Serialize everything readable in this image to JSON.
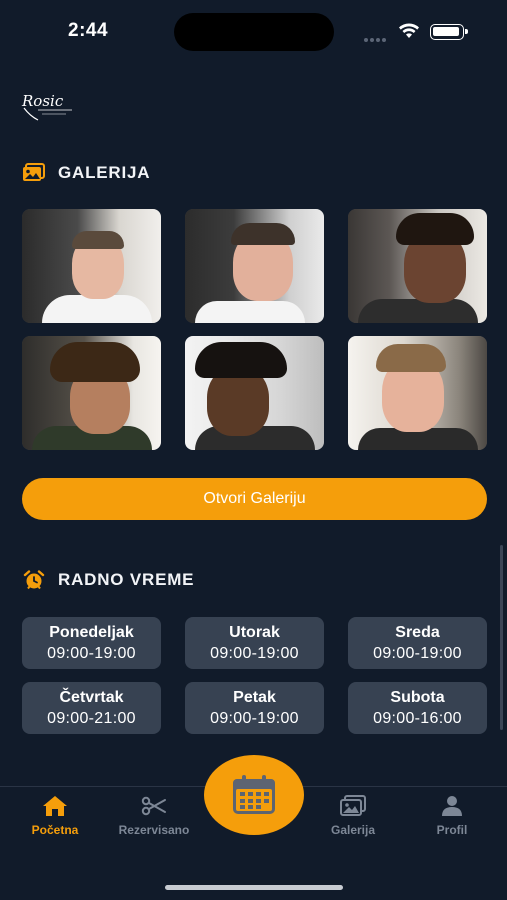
{
  "status_bar": {
    "time": "2:44"
  },
  "logo": {
    "name": "Rosic"
  },
  "gallery": {
    "title": "GALERIJA",
    "button_label": "Otvori Galeriju",
    "photos": [
      "haircut-photo",
      "haircut-photo",
      "haircut-photo",
      "haircut-photo",
      "haircut-photo",
      "haircut-photo"
    ]
  },
  "hours": {
    "title": "RADNO VREME",
    "days": [
      {
        "day": "Ponedeljak",
        "time": "09:00-19:00"
      },
      {
        "day": "Utorak",
        "time": "09:00-19:00"
      },
      {
        "day": "Sreda",
        "time": "09:00-19:00"
      },
      {
        "day": "Četvrtak",
        "time": "09:00-21:00"
      },
      {
        "day": "Petak",
        "time": "09:00-19:00"
      },
      {
        "day": "Subota",
        "time": "09:00-16:00"
      }
    ]
  },
  "tab_bar": {
    "home": "Početna",
    "reserved": "Rezervisano",
    "gallery": "Galerija",
    "profile": "Profil",
    "active": "home"
  },
  "colors": {
    "background": "#111b2a",
    "accent": "#f59e0b",
    "card": "#374252",
    "inactive": "#7d8796"
  }
}
